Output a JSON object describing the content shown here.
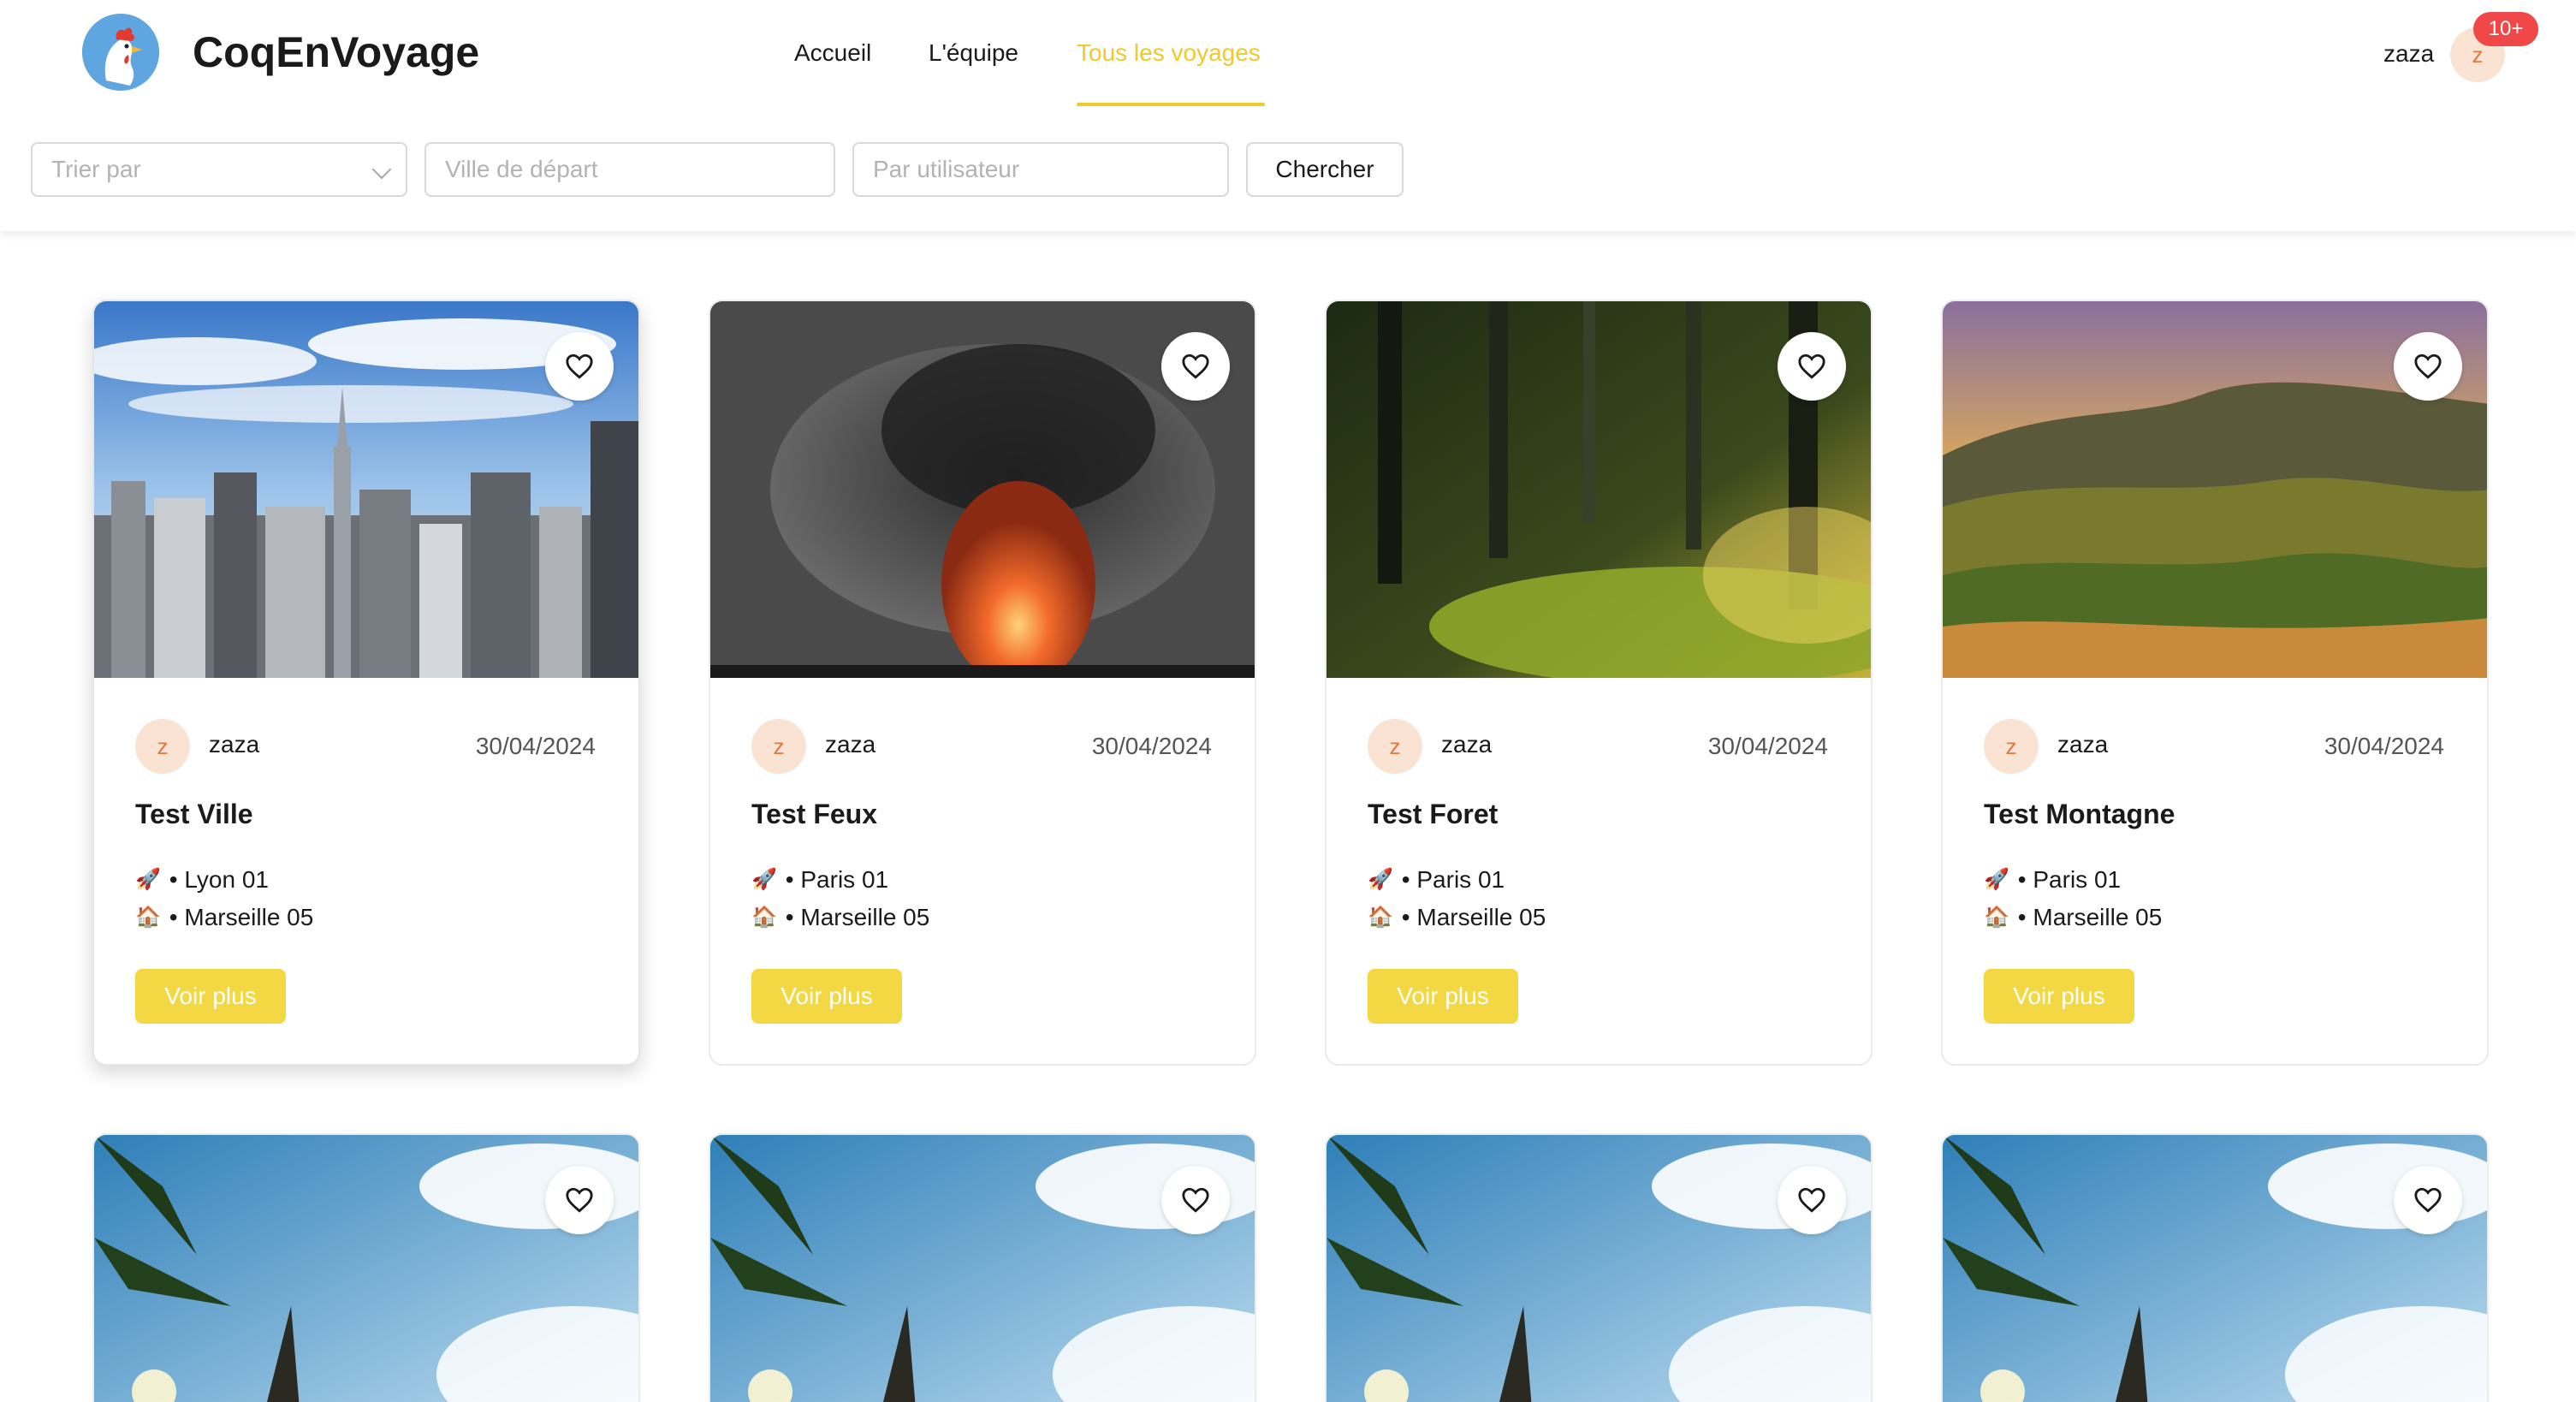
{
  "header": {
    "brand": "CoqEnVoyage",
    "nav": [
      {
        "label": "Accueil"
      },
      {
        "label": "L'équipe"
      },
      {
        "label": "Tous les voyages"
      }
    ],
    "user": {
      "name": "zaza",
      "avatar_letter": "z",
      "notifications": "10+"
    }
  },
  "filters": {
    "sort_placeholder": "Trier par",
    "departure_placeholder": "Ville de départ",
    "user_placeholder": "Par utilisateur",
    "search_label": "Chercher"
  },
  "cards": [
    {
      "user": "zaza",
      "avatar_letter": "z",
      "date": "30/04/2024",
      "title": "Test Ville",
      "departure_icon": "🚀",
      "departure": "Lyon 01",
      "arrival_icon": "🏠",
      "arrival": "Marseille 05",
      "cta": "Voir plus"
    },
    {
      "user": "zaza",
      "avatar_letter": "z",
      "date": "30/04/2024",
      "title": "Test Feux",
      "departure_icon": "🚀",
      "departure": "Paris 01",
      "arrival_icon": "🏠",
      "arrival": "Marseille 05",
      "cta": "Voir plus"
    },
    {
      "user": "zaza",
      "avatar_letter": "z",
      "date": "30/04/2024",
      "title": "Test Foret",
      "departure_icon": "🚀",
      "departure": "Paris 01",
      "arrival_icon": "🏠",
      "arrival": "Marseille 05",
      "cta": "Voir plus"
    },
    {
      "user": "zaza",
      "avatar_letter": "z",
      "date": "30/04/2024",
      "title": "Test Montagne",
      "departure_icon": "🚀",
      "departure": "Paris 01",
      "arrival_icon": "🏠",
      "arrival": "Marseille 05",
      "cta": "Voir plus"
    }
  ],
  "colors": {
    "accent": "#f4d843",
    "nav_active": "#f0c92a",
    "badge": "#f04848",
    "avatar_bg": "#fbe3d4"
  }
}
